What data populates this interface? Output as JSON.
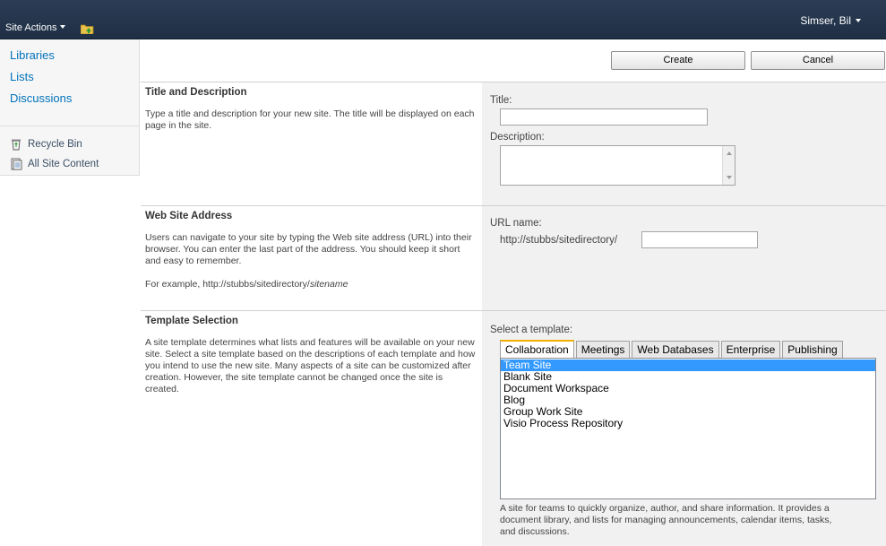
{
  "ribbon": {
    "site_actions_label": "Site Actions",
    "user_name": "Simser, Bil"
  },
  "leftnav": {
    "links": [
      "Libraries",
      "Lists",
      "Discussions"
    ],
    "bottom": [
      "Recycle Bin",
      "All Site Content"
    ]
  },
  "buttons": {
    "create": "Create",
    "cancel": "Cancel"
  },
  "title_section": {
    "heading": "Title and Description",
    "description": "Type a title and description for your new site. The title will be displayed on each page in the site.",
    "title_label": "Title:",
    "title_value": "",
    "description_label": "Description:",
    "description_value": ""
  },
  "address_section": {
    "heading": "Web Site Address",
    "description": "Users can navigate to your site by typing the Web site address (URL) into their browser. You can enter the last part of the address. You should keep it short and easy to remember.",
    "example_prefix": "For example, http://stubbs/sitedirectory/",
    "example_italic": "sitename",
    "url_label": "URL name:",
    "url_prefix": "http://stubbs/sitedirectory/",
    "url_value": ""
  },
  "template_section": {
    "heading": "Template Selection",
    "description": "A site template determines what lists and features will be available on your new site. Select a site template based on the descriptions of each template and how you intend to use the new site. Many aspects of a site can be customized after creation. However, the site template cannot be changed once the site is created.",
    "select_label": "Select a template:",
    "tabs": [
      "Collaboration",
      "Meetings",
      "Web Databases",
      "Enterprise",
      "Publishing"
    ],
    "active_tab": "Collaboration",
    "templates": [
      "Team Site",
      "Blank Site",
      "Document Workspace",
      "Blog",
      "Group Work Site",
      "Visio Process Repository"
    ],
    "selected_template": "Team Site",
    "template_description": "A site for teams to quickly organize, author, and share information. It provides a document library, and lists for managing announcements, calendar items, tasks, and discussions."
  },
  "colors": {
    "ribbon": "#1f2f45",
    "link": "#0072bc",
    "selection": "#3399ff",
    "active_tab_accent": "#f0b000"
  }
}
